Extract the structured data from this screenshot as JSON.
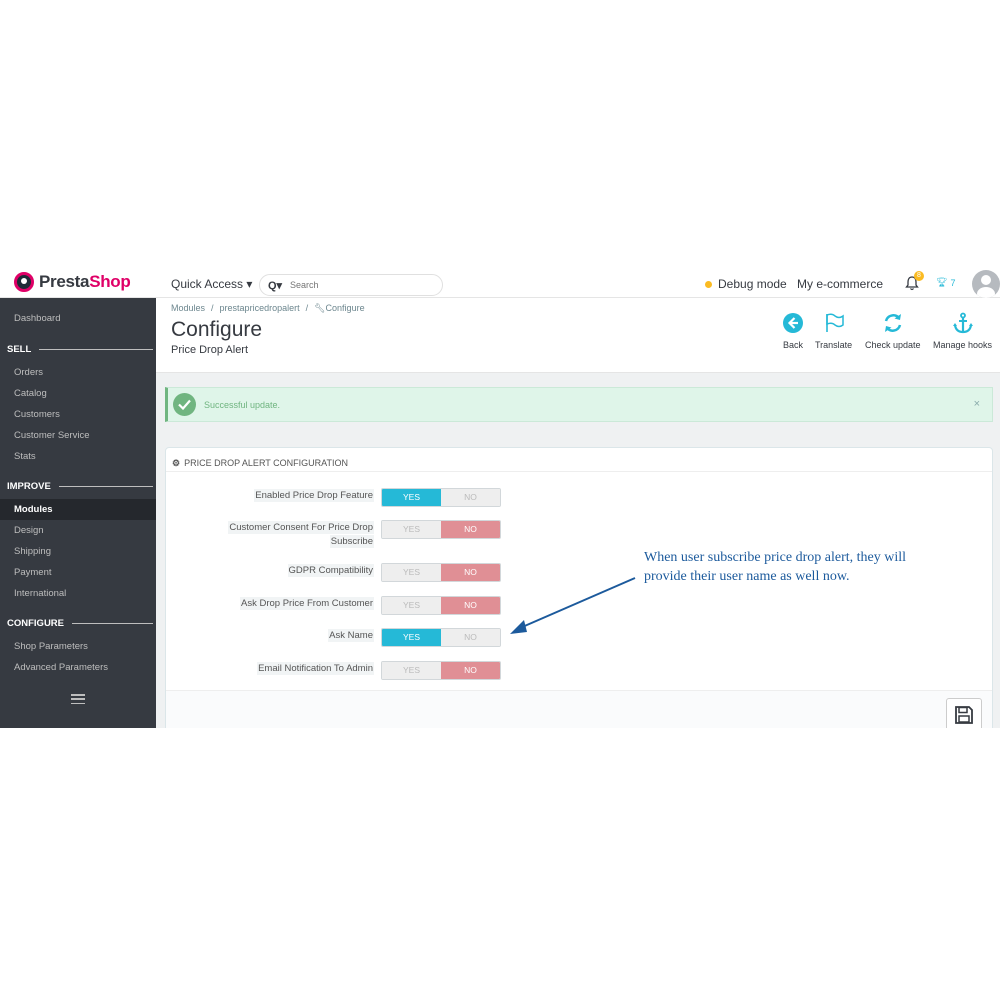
{
  "header": {
    "logo_prefix": "Presta",
    "logo_suffix": "Shop",
    "quick_access": "Quick Access ▾",
    "search_placeholder": "Search",
    "debug_mode": "Debug mode",
    "shop_name": "My e-commerce",
    "notification_count": "8",
    "trophy_count": "7"
  },
  "sidebar": {
    "dashboard": "Dashboard",
    "sections": [
      {
        "title": "SELL",
        "items": [
          "Orders",
          "Catalog",
          "Customers",
          "Customer Service",
          "Stats"
        ]
      },
      {
        "title": "IMPROVE",
        "items": [
          "Modules",
          "Design",
          "Shipping",
          "Payment",
          "International"
        ]
      },
      {
        "title": "CONFIGURE",
        "items": [
          "Shop Parameters",
          "Advanced Parameters"
        ]
      }
    ],
    "active_item": "Modules"
  },
  "breadcrumb": [
    "Modules",
    "/",
    "prestapricedropalert",
    "/",
    "Configure"
  ],
  "page": {
    "title": "Configure",
    "subtitle": "Price Drop Alert"
  },
  "toolbar": [
    {
      "label": "Back",
      "icon": "back-icon"
    },
    {
      "label": "Translate",
      "icon": "flag-icon"
    },
    {
      "label": "Check update",
      "icon": "refresh-icon"
    },
    {
      "label": "Manage hooks",
      "icon": "anchor-icon"
    }
  ],
  "alert": {
    "text": "Successful update.",
    "close": "×"
  },
  "panel": {
    "heading": "PRICE DROP ALERT CONFIGURATION",
    "rows": [
      {
        "label": "Enabled Price Drop Feature",
        "value": "YES"
      },
      {
        "label": "Customer Consent For Price Drop Subscribe",
        "value": "NO"
      },
      {
        "label": "GDPR Compatibility",
        "value": "NO"
      },
      {
        "label": "Ask Drop Price From Customer",
        "value": "NO"
      },
      {
        "label": "Ask Name",
        "value": "YES"
      },
      {
        "label": "Email Notification To Admin",
        "value": "NO"
      }
    ],
    "yes_label": "YES",
    "no_label": "NO"
  },
  "annotation": {
    "text": "When user subscribe price drop alert, they will provide their user name as well now."
  },
  "colors": {
    "sidebar_bg": "#363a41",
    "accent": "#25b9d7",
    "no_active": "#e08f95",
    "success": "#70b580",
    "annotation": "#1c5a9c"
  }
}
